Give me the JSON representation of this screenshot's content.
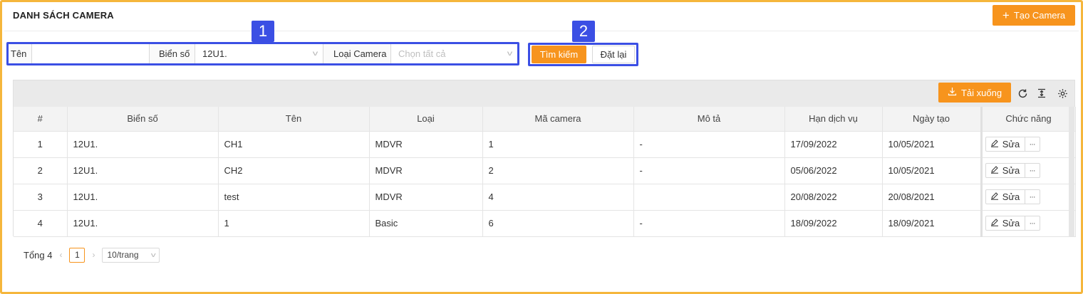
{
  "header": {
    "title": "DANH SÁCH CAMERA",
    "create_button": "Tạo Camera"
  },
  "filters": {
    "name_label": "Tên",
    "name_value": "",
    "plate_label": "Biển số",
    "plate_value": "12U1.",
    "camera_type_label": "Loại Camera",
    "camera_type_placeholder": "Chọn tất cả",
    "search_button": "Tìm kiếm",
    "reset_button": "Đặt lại"
  },
  "annotations": {
    "badge_1": "1",
    "badge_2": "2",
    "highlight_color": "#3b4fe4"
  },
  "toolbar": {
    "download_button": "Tải xuống",
    "icons": [
      "download-icon",
      "refresh-icon",
      "column-height-icon",
      "settings-icon"
    ]
  },
  "table": {
    "columns": [
      "#",
      "Biển số",
      "Tên",
      "Loại",
      "Mã camera",
      "Mô tả",
      "Hạn dịch vụ",
      "Ngày tạo",
      "Chức năng"
    ],
    "rows": [
      {
        "index": "1",
        "plate": "12U1.",
        "name": "CH1",
        "type": "MDVR",
        "code": "1",
        "description": "-",
        "expiry": "17/09/2022",
        "created": "10/05/2021"
      },
      {
        "index": "2",
        "plate": "12U1.",
        "name": "CH2",
        "type": "MDVR",
        "code": "2",
        "description": "-",
        "expiry": "05/06/2022",
        "created": "10/05/2021"
      },
      {
        "index": "3",
        "plate": "12U1.",
        "name": "test",
        "type": "MDVR",
        "code": "4",
        "description": "",
        "expiry": "20/08/2022",
        "created": "20/08/2021"
      },
      {
        "index": "4",
        "plate": "12U1.",
        "name": "1",
        "type": "Basic",
        "code": "6",
        "description": "-",
        "expiry": "18/09/2022",
        "created": "18/09/2021"
      }
    ],
    "edit_label": "Sửa",
    "more_label": "···"
  },
  "pagination": {
    "total_text": "Tổng 4",
    "current_page": "1",
    "page_size": "10/trang",
    "prev_arrow": "‹",
    "next_arrow": "›"
  },
  "colors": {
    "accent": "#f7941d",
    "frame": "#f5b63c"
  }
}
